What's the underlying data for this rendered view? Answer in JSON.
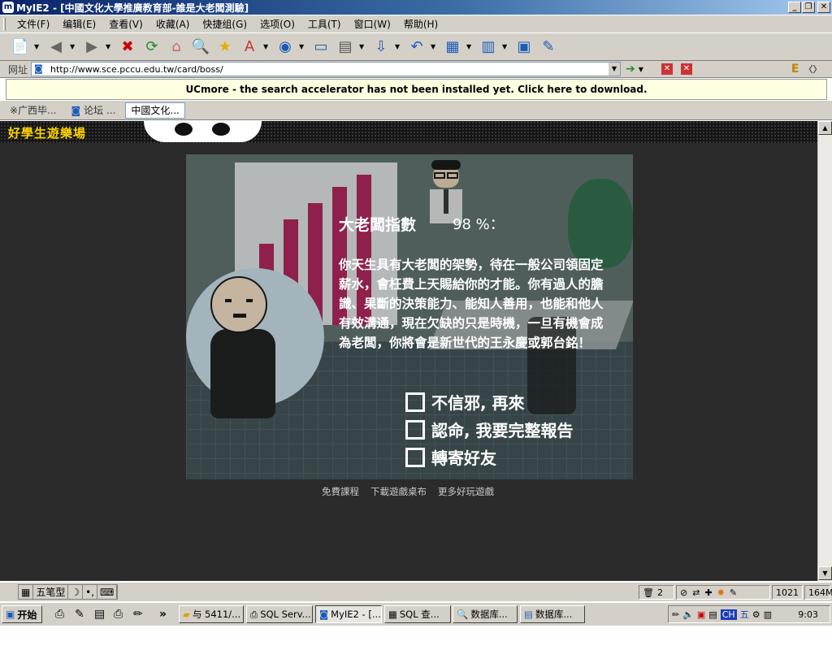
{
  "window": {
    "title": "MyIE2 - [中國文化大學推廣教育部-誰是大老闆測驗]",
    "buttons": {
      "minimize": "_",
      "maximize": "❐",
      "close": "✕"
    }
  },
  "menu": [
    {
      "label": "文件(F)"
    },
    {
      "label": "编辑(E)"
    },
    {
      "label": "查看(V)"
    },
    {
      "label": "收藏(A)"
    },
    {
      "label": "快捷组(G)"
    },
    {
      "label": "选项(O)"
    },
    {
      "label": "工具(T)"
    },
    {
      "label": "窗口(W)"
    },
    {
      "label": "帮助(H)"
    }
  ],
  "address": {
    "label": "网址",
    "url": "http://www.sce.pccu.edu.tw/card/boss/"
  },
  "ucmore": {
    "message": "UCmore - the search accelerator has not been installed yet. Click here to download."
  },
  "tabs": [
    {
      "label": "※广西毕..."
    },
    {
      "label": "论坛 ..."
    },
    {
      "label": "中國文化..."
    }
  ],
  "site": {
    "logo_text": "好學生遊樂場"
  },
  "game": {
    "result_title": "大老闆指數",
    "result_percent": "98 %：",
    "result_text": "你天生具有大老闆的架勢，待在一般公司領固定薪水，會枉費上天賜給你的才能。你有過人的膽識、果斷的決策能力、能知人善用，也能和他人有效溝通，現在欠缺的只是時機，一旦有機會成為老闆，你將會是新世代的王永慶或郭台銘！",
    "options": [
      {
        "label": "不信邪, 再來"
      },
      {
        "label": "認命, 我要完整報告"
      },
      {
        "label": "轉寄好友"
      }
    ],
    "footer_links": [
      {
        "label": "免費課程"
      },
      {
        "label": "下載遊戲桌布"
      },
      {
        "label": "更多好玩遊戲"
      }
    ]
  },
  "statusbar": {
    "ime": [
      "五笔型"
    ],
    "tab_count": "2",
    "resolution": "1021",
    "memory": "164M"
  },
  "taskbar": {
    "start_label": "开始",
    "buttons": [
      {
        "label": "与 5411/..."
      },
      {
        "label": "SQL Serv..."
      },
      {
        "label": "MyIE2 - [..."
      },
      {
        "label": "SQL 查..."
      },
      {
        "label": "数据库..."
      },
      {
        "label": "数据库..."
      }
    ],
    "clock": "9:03",
    "tray_ime": "CH"
  }
}
